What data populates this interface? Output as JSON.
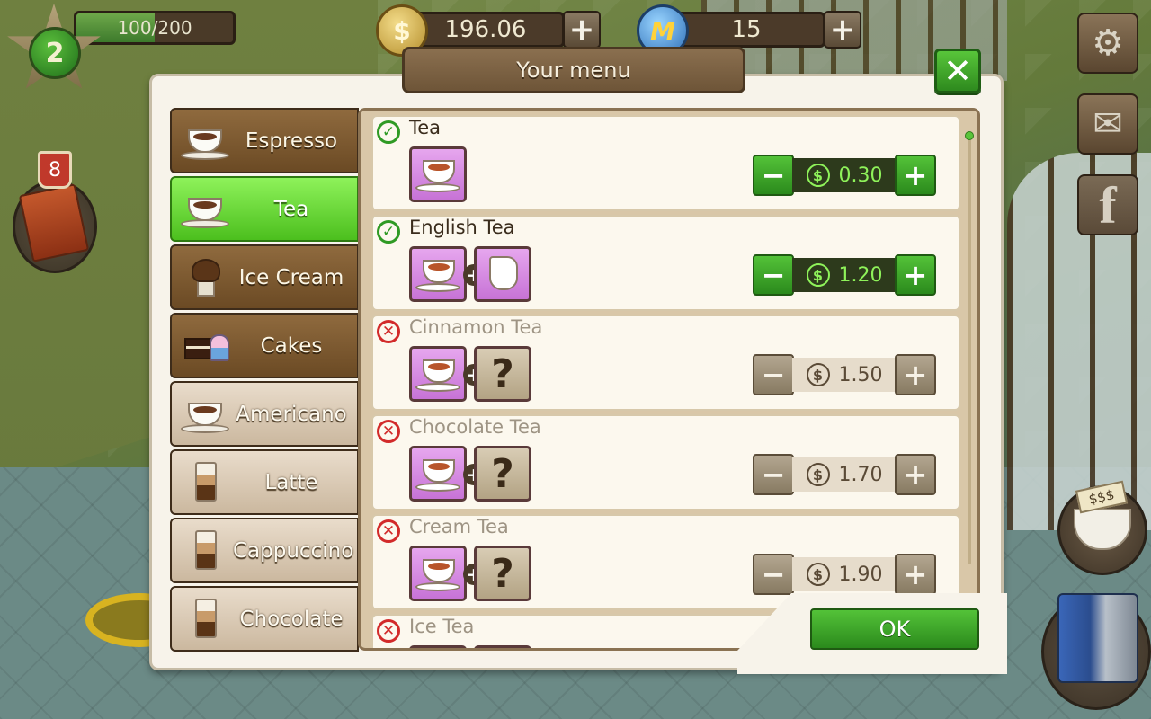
{
  "hud": {
    "level": "2",
    "xp_text": "100/200",
    "xp_progress": 0.5,
    "coins": "196.06",
    "megabucks": "15",
    "coin_symbol": "$",
    "megabucks_symbol": "M",
    "plus": "+",
    "recipe_book_count": "8",
    "price_tag": "$$$",
    "facebook": "f"
  },
  "dialog": {
    "title": "Your menu",
    "close": "✕",
    "ok": "OK"
  },
  "categories": [
    {
      "label": "Espresso",
      "state": "locked"
    },
    {
      "label": "Tea",
      "state": "active"
    },
    {
      "label": "Ice Cream",
      "state": "locked"
    },
    {
      "label": "Cakes",
      "state": "locked"
    },
    {
      "label": "Americano",
      "state": "unlocked"
    },
    {
      "label": "Latte",
      "state": "unlocked"
    },
    {
      "label": "Cappuccino",
      "state": "unlocked"
    },
    {
      "label": "Chocolate",
      "state": "unlocked"
    }
  ],
  "items": [
    {
      "name": "Tea",
      "price": "0.30",
      "available": true,
      "ingredients": [
        "tea"
      ]
    },
    {
      "name": "English Tea",
      "price": "1.20",
      "available": true,
      "ingredients": [
        "tea",
        "milk"
      ]
    },
    {
      "name": "Cinnamon Tea",
      "price": "1.50",
      "available": false,
      "ingredients": [
        "tea",
        "unknown"
      ]
    },
    {
      "name": "Chocolate Tea",
      "price": "1.70",
      "available": false,
      "ingredients": [
        "tea",
        "unknown"
      ]
    },
    {
      "name": "Cream Tea",
      "price": "1.90",
      "available": false,
      "ingredients": [
        "tea",
        "unknown"
      ]
    },
    {
      "name": "Ice Tea",
      "price": "",
      "available": false,
      "ingredients": [
        "tea",
        "unknown"
      ]
    }
  ],
  "symbols": {
    "check": "✓",
    "cross": "✕",
    "minus": "−",
    "plus": "+",
    "dollar": "$",
    "unknown": "?"
  },
  "colors": {
    "active_green": "#4cbf1e",
    "locked_brown": "#6b4a24",
    "price_active": "#8ef25a",
    "status_ok": "#2f9a24",
    "status_no": "#d22a2a"
  }
}
